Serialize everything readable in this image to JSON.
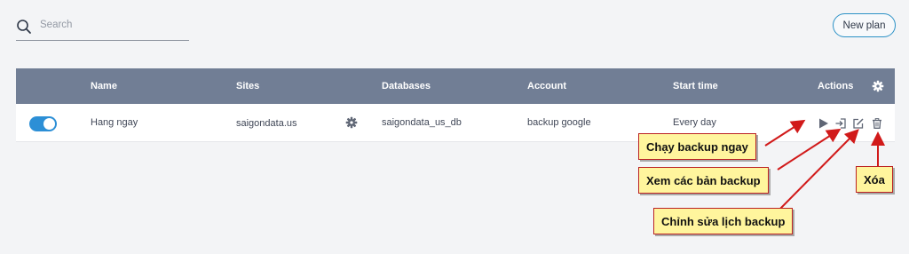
{
  "search": {
    "placeholder": "Search"
  },
  "toolbar": {
    "new_plan_label": "New plan"
  },
  "table": {
    "headers": {
      "name": "Name",
      "sites": "Sites",
      "databases": "Databases",
      "account": "Account",
      "start_time": "Start time",
      "actions": "Actions"
    },
    "rows": [
      {
        "enabled": true,
        "name": "Hang ngay",
        "site": "saigondata.us",
        "database": "saigondata_us_db",
        "account": "backup google",
        "start_time": "Every day"
      }
    ]
  },
  "annotations": {
    "run_now": "Chạy backup ngay",
    "view_backups": "Xem các bản backup",
    "edit_schedule": "Chỉnh sửa lịch backup",
    "delete": "Xóa"
  },
  "colors": {
    "header_bg": "#717e95",
    "toggle_on": "#2c8fd6",
    "new_plan_border": "#2b91c6",
    "callout_bg": "#fff59d",
    "arrow": "#d11a1a"
  },
  "icons": {
    "search": "search-icon",
    "settings": "gear-icon",
    "site_settings": "gear-icon",
    "run": "play-icon",
    "view": "login-icon",
    "edit": "edit-icon",
    "delete": "trash-icon"
  }
}
